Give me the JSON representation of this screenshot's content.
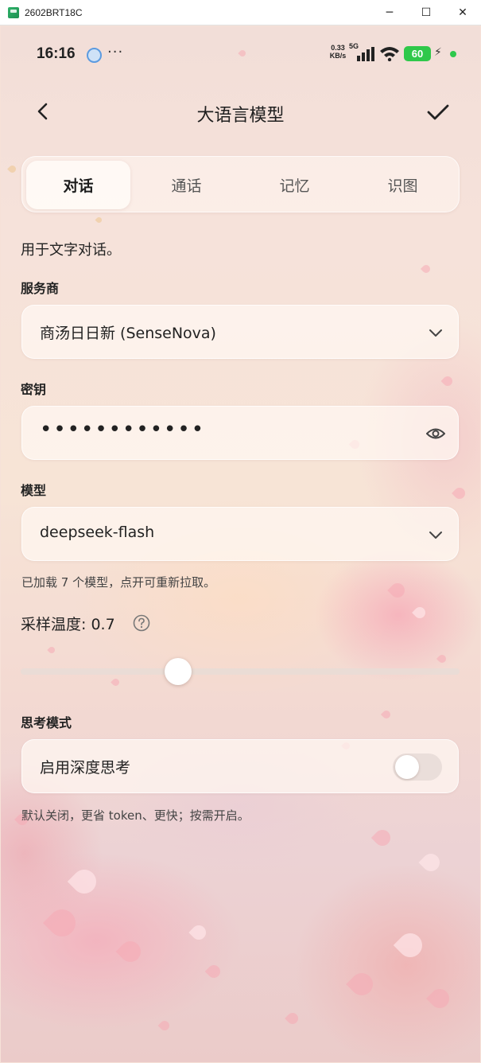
{
  "window": {
    "title": "2602BRT18C",
    "minimize": "─",
    "maximize": "☐",
    "close": "✕"
  },
  "status_bar": {
    "time": "16:16",
    "more": "···",
    "net_speed_value": "0.33",
    "net_speed_unit": "KB/s",
    "network_type": "5G",
    "battery": "60"
  },
  "header": {
    "title": "大语言模型"
  },
  "tabs": [
    {
      "label": "对话",
      "active": true
    },
    {
      "label": "通话",
      "active": false
    },
    {
      "label": "记忆",
      "active": false
    },
    {
      "label": "识图",
      "active": false
    }
  ],
  "content": {
    "description": "用于文字对话。",
    "provider_label": "服务商",
    "provider_value": "商汤日日新 (SenseNova)",
    "key_label": "密钥",
    "key_value": "••••••••••••",
    "model_label": "模型",
    "model_value": "deepseek-flash",
    "model_hint": "已加载 7 个模型，点开可重新拉取。",
    "temperature_label": "采样温度: 0.7",
    "temperature_value": 0.7,
    "temperature_slider_fraction": 0.35,
    "thinking_label": "思考模式",
    "thinking_toggle_label": "启用深度思考",
    "thinking_enabled": false,
    "thinking_hint": "默认关闭，更省 token、更快；按需开启。"
  },
  "colors": {
    "battery": "#2fc84a",
    "status_dot": "#2ec84c",
    "text": "#222222"
  },
  "icons": [
    "back-icon",
    "check-icon",
    "chevron-down-icon",
    "eye-icon",
    "help-icon",
    "signal-icon",
    "wifi-icon",
    "bolt-icon"
  ]
}
